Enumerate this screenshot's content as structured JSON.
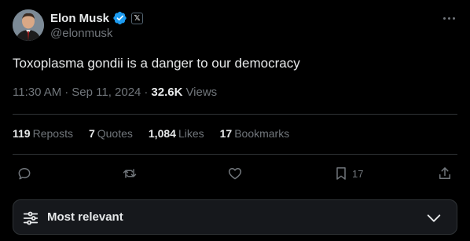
{
  "author": {
    "display_name": "Elon Musk",
    "handle": "@elonmusk",
    "verified_badge_color": "#1d9bf0",
    "affiliation_badge": "𝕏"
  },
  "tweet": {
    "text": "Toxoplasma gondii is a danger to our democracy",
    "time": "11:30 AM",
    "separator": "·",
    "date": "Sep 11, 2024",
    "views_count": "32.6K",
    "views_label": "Views"
  },
  "stats": {
    "reposts": {
      "count": "119",
      "label": "Reposts"
    },
    "quotes": {
      "count": "7",
      "label": "Quotes"
    },
    "likes": {
      "count": "1,084",
      "label": "Likes"
    },
    "bookmarks": {
      "count": "17",
      "label": "Bookmarks"
    }
  },
  "actions": {
    "reply_icon": "reply-icon",
    "repost_icon": "repost-icon",
    "like_icon": "heart-icon",
    "bookmark_icon": "bookmark-icon",
    "bookmark_count": "17",
    "share_icon": "share-icon"
  },
  "sort": {
    "label": "Most relevant",
    "icon": "sliders-icon",
    "chevron": "chevron-down-icon"
  },
  "colors": {
    "background": "#000000",
    "text_primary": "#e7e9ea",
    "text_secondary": "#71767b",
    "divider": "#2f3336",
    "sort_bar_bg": "#16181c"
  }
}
